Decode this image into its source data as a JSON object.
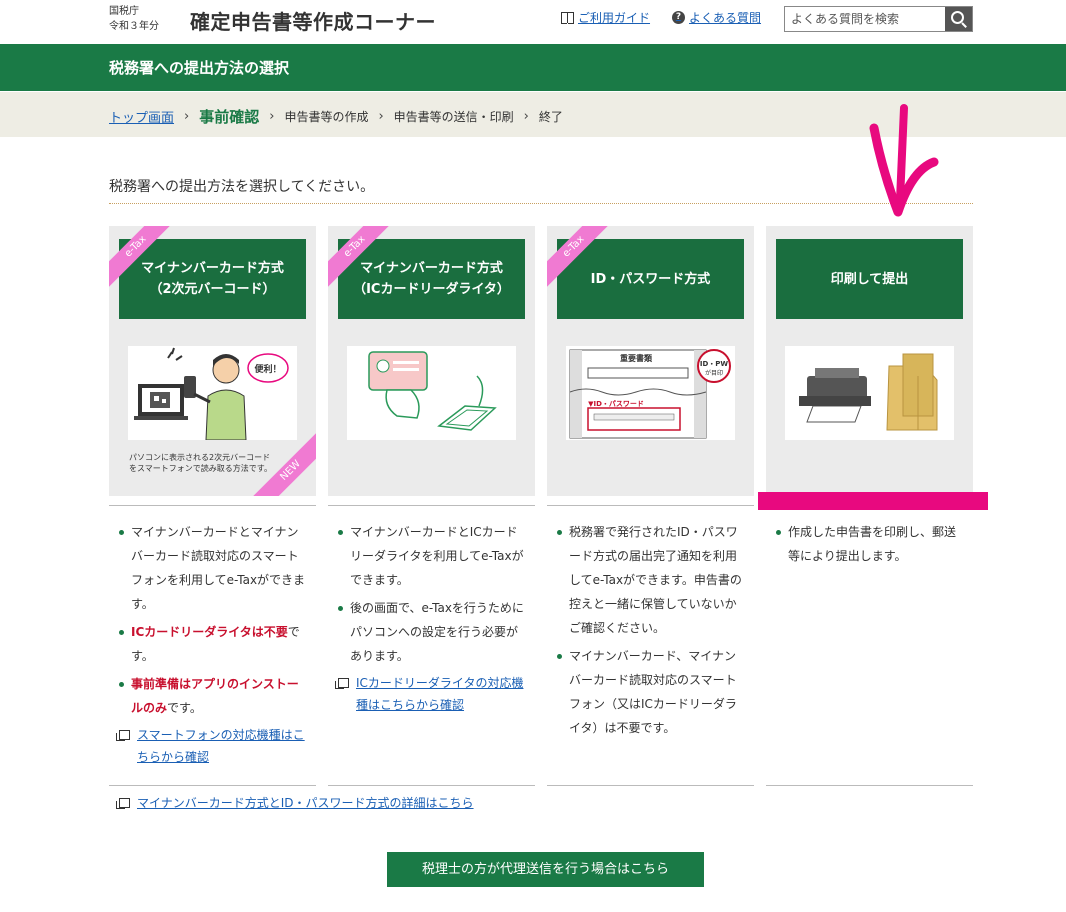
{
  "header": {
    "org_line1": "国税庁",
    "org_line2": "令和３年分",
    "title": "確定申告書等作成コーナー",
    "guide_link": "ご利用ガイド",
    "faq_link": "よくある質問",
    "search_placeholder": "よくある質問を検索",
    "q_glyph": "?"
  },
  "page_title": "税務署への提出方法の選択",
  "breadcrumb": {
    "home": "トップ画面",
    "current": "事前確認",
    "step3": "申告書等の作成",
    "step4": "申告書等の送信・印刷",
    "step5": "終了",
    "sep": "›"
  },
  "instruction": "税務署への提出方法を選択してください。",
  "cards": [
    {
      "ribbon": "e-Tax",
      "line1": "マイナンバーカード方式",
      "line2": "（2次元バーコード）",
      "caption1": "パソコンに表示される2次元バーコード",
      "caption2": "をスマートフォンで読み取る方法です。",
      "bubble": "便利！",
      "new_ribbon": "NEW",
      "desc1a": "マイナンバーカードとマイナンバーカード読取対応のスマートフォンを利用してe-Taxができます。",
      "desc2_red": "ICカードリーダライタは不要",
      "desc2_rest": "です。",
      "desc3_red": "事前準備はアプリのインストールのみ",
      "desc3_rest": "です。",
      "link": "スマートフォンの対応機種はこちらから確認"
    },
    {
      "ribbon": "e-Tax",
      "line1": "マイナンバーカード方式",
      "line2": "（ICカードリーダライタ）",
      "desc1": "マイナンバーカードとICカードリーダライタを利用してe-Taxができます。",
      "desc2": "後の画面で、e-Taxを行うためにパソコンへの設定を行う必要があります。",
      "link": "ICカードリーダライタの対応機種はこちらから確認"
    },
    {
      "ribbon": "e-Tax",
      "line1": "ID・パスワード方式",
      "illus_title": "重要書類",
      "illus_badge1": "ID・PW",
      "illus_badge2": "が目印",
      "illus_label": "▼ID・パスワード",
      "desc1": "税務署で発行されたID・パスワード方式の届出完了通知を利用してe-Taxができます。申告書の控えと一緒に保管していないかご確認ください。",
      "desc2": "マイナンバーカード、マイナンバーカード読取対応のスマートフォン（又はICカードリーダライタ）は不要です。"
    },
    {
      "line1": "印刷して提出",
      "desc1": "作成した申告書を印刷し、郵送等により提出します。"
    }
  ],
  "bottom_link": "マイナンバーカード方式とID・パスワード方式の詳細はこちら",
  "proxy_button": "税理士の方が代理送信を行う場合はこちら",
  "colors": {
    "brand_green": "#1a7a46",
    "button_green": "#1a6e3f",
    "etax_pink": "#f07ad2",
    "annotation_magenta": "#e8097f",
    "warning_red": "#c8102e",
    "link_blue": "#1a5fb4"
  }
}
